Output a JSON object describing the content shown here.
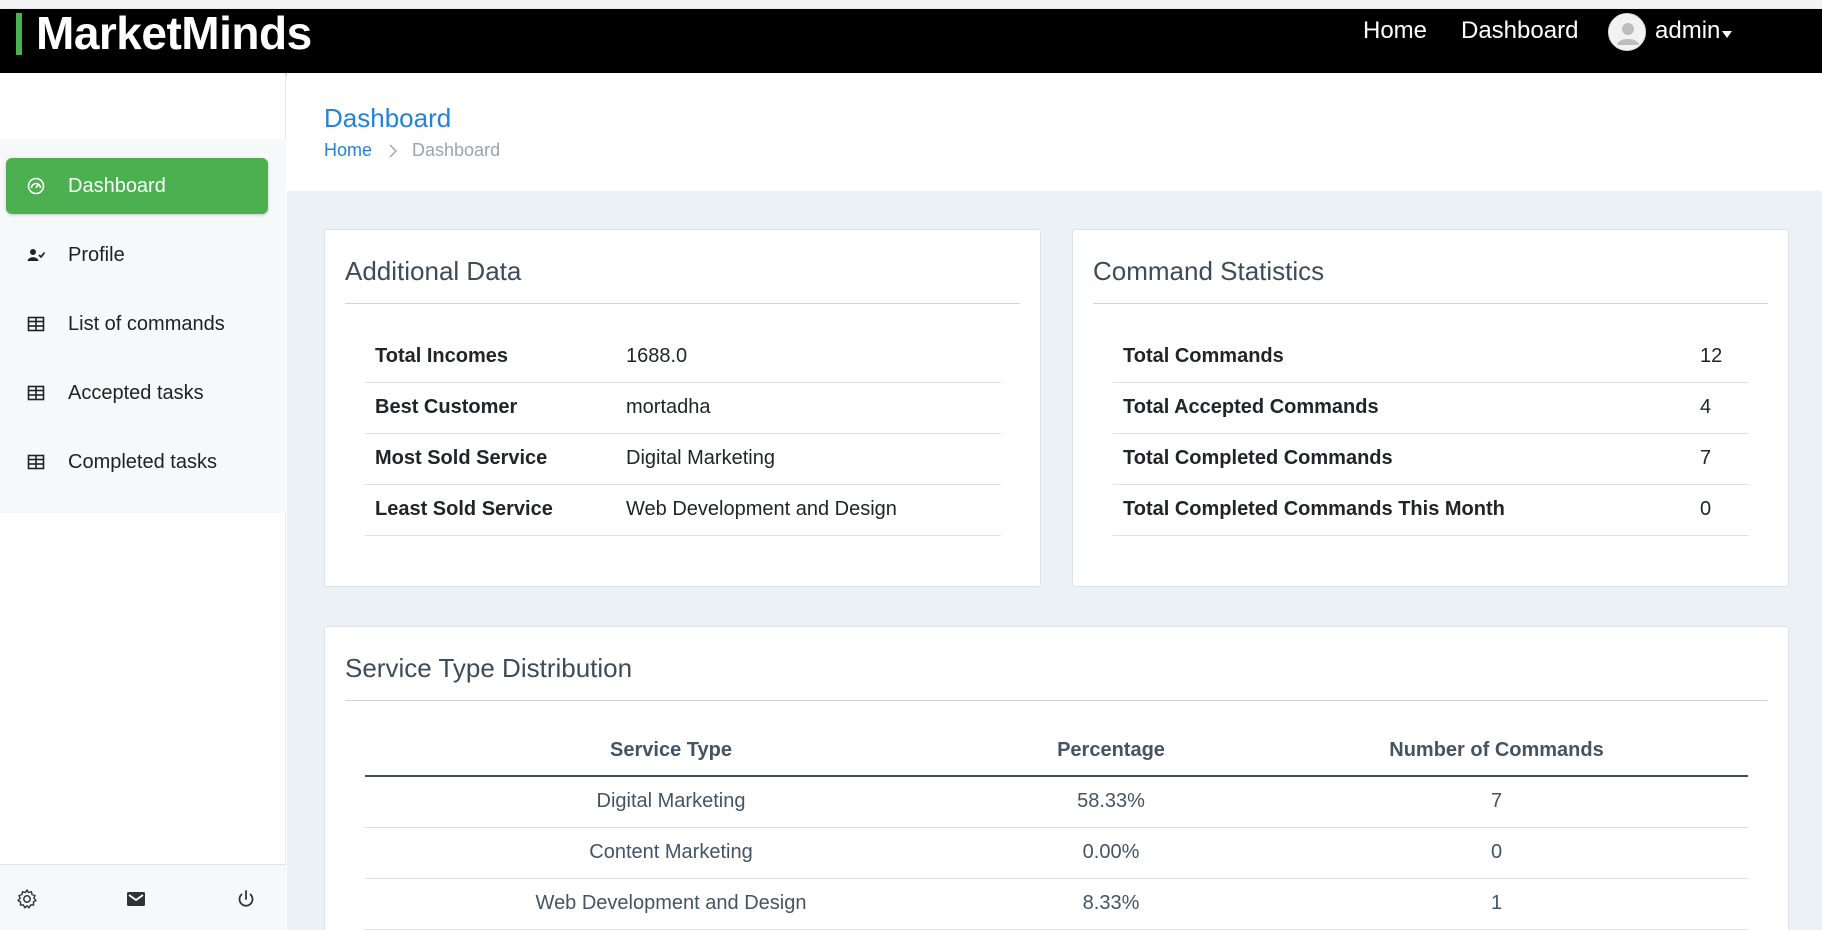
{
  "app": {
    "brand": "MarketMinds",
    "accent_color": "#4caf50"
  },
  "navbar": {
    "home_label": "Home",
    "dashboard_label": "Dashboard",
    "user_label": "admin"
  },
  "sidebar": {
    "items": [
      {
        "label": "Dashboard",
        "icon": "dashboard-gauge-icon",
        "active": true
      },
      {
        "label": "Profile",
        "icon": "user-check-icon",
        "active": false
      },
      {
        "label": "List of commands",
        "icon": "table-icon",
        "active": false
      },
      {
        "label": "Accepted tasks",
        "icon": "table-icon",
        "active": false
      },
      {
        "label": "Completed tasks",
        "icon": "table-icon",
        "active": false
      }
    ],
    "footer_icons": [
      "settings-gear-icon",
      "mail-icon",
      "power-icon"
    ]
  },
  "header": {
    "title": "Dashboard",
    "breadcrumb": {
      "home": "Home",
      "current": "Dashboard"
    }
  },
  "additional_data": {
    "title": "Additional Data",
    "rows": [
      {
        "label": "Total Incomes",
        "value": "1688.0"
      },
      {
        "label": "Best Customer",
        "value": "mortadha"
      },
      {
        "label": "Most Sold Service",
        "value": "Digital Marketing"
      },
      {
        "label": "Least Sold Service",
        "value": "Web Development and Design"
      }
    ]
  },
  "command_statistics": {
    "title": "Command Statistics",
    "rows": [
      {
        "label": "Total Commands",
        "value": "12"
      },
      {
        "label": "Total Accepted Commands",
        "value": "4"
      },
      {
        "label": "Total Completed Commands",
        "value": "7"
      },
      {
        "label": "Total Completed Commands This Month",
        "value": "0"
      }
    ]
  },
  "service_distribution": {
    "title": "Service Type Distribution",
    "columns": [
      "Service Type",
      "Percentage",
      "Number of Commands"
    ],
    "rows": [
      [
        "Digital Marketing",
        "58.33%",
        "7"
      ],
      [
        "Content Marketing",
        "0.00%",
        "0"
      ],
      [
        "Web Development and Design",
        "8.33%",
        "1"
      ]
    ]
  }
}
